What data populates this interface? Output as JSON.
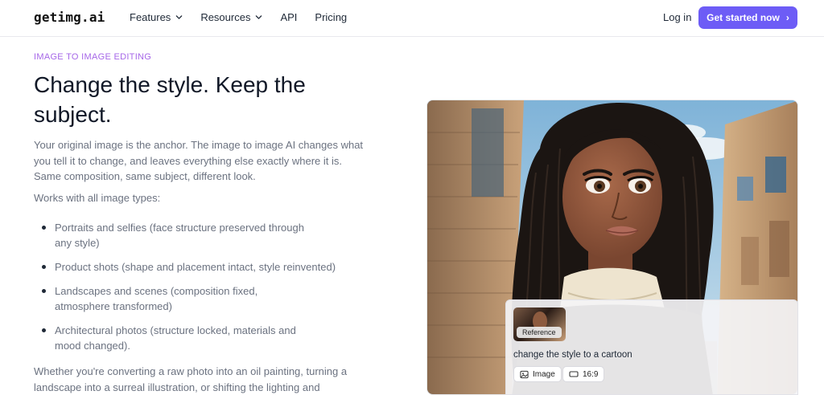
{
  "nav": {
    "logo": "getimg.ai",
    "links": [
      {
        "label": "Features",
        "dropdown": true
      },
      {
        "label": "Resources",
        "dropdown": true
      },
      {
        "label": "API",
        "dropdown": false
      },
      {
        "label": "Pricing",
        "dropdown": false
      }
    ],
    "login": "Log in",
    "cta": "Get started now",
    "cta_icon": "chevron-right-icon"
  },
  "hero": {
    "eyebrow": "IMAGE TO IMAGE EDITING",
    "headline": "Change the style. Keep the subject.",
    "intro": "Your original image is the anchor. The image to image AI changes what you tell it to change, and leaves everything else exactly where it is. Same composition, same subject, different look.",
    "works_with": "Works with all image types:",
    "bullets": [
      "Portraits and selfies (face structure preserved through any style)",
      "Product shots (shape and placement intact, style reinvented)",
      "Landscapes and scenes (composition fixed, atmosphere transformed)",
      "Architectural photos (structure locked, materials and mood changed)."
    ],
    "closing": "Whether you're converting a raw photo into an oil painting, turning a landscape into a surreal illustration, or shifting the lighting and"
  },
  "demo": {
    "image_alt": "cartoon portrait of woman with long braids",
    "reference_label": "Reference",
    "prompt": "change the style to a cartoon",
    "chip_image": "Image",
    "chip_ratio": "16:9"
  },
  "colors": {
    "accent": "#6d5cf6",
    "eyebrow": "#a667e8",
    "body_text": "#6b7280"
  }
}
